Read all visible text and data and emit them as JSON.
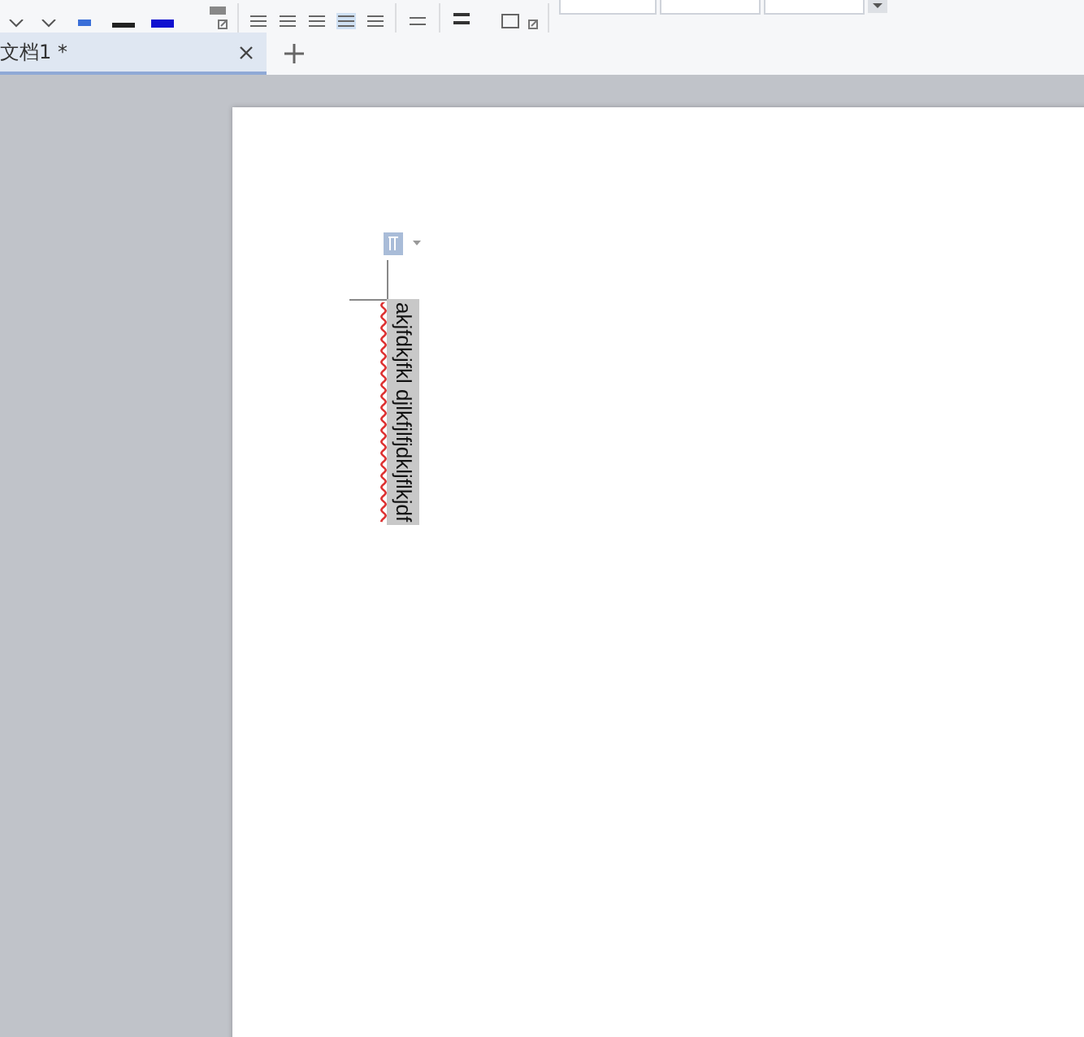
{
  "tabs": [
    {
      "title": "文档1 *",
      "selected": true
    }
  ],
  "document": {
    "vertical_text": "akjfdkjfkl djlkfjlfjdkljflkjdf",
    "selected": true
  }
}
